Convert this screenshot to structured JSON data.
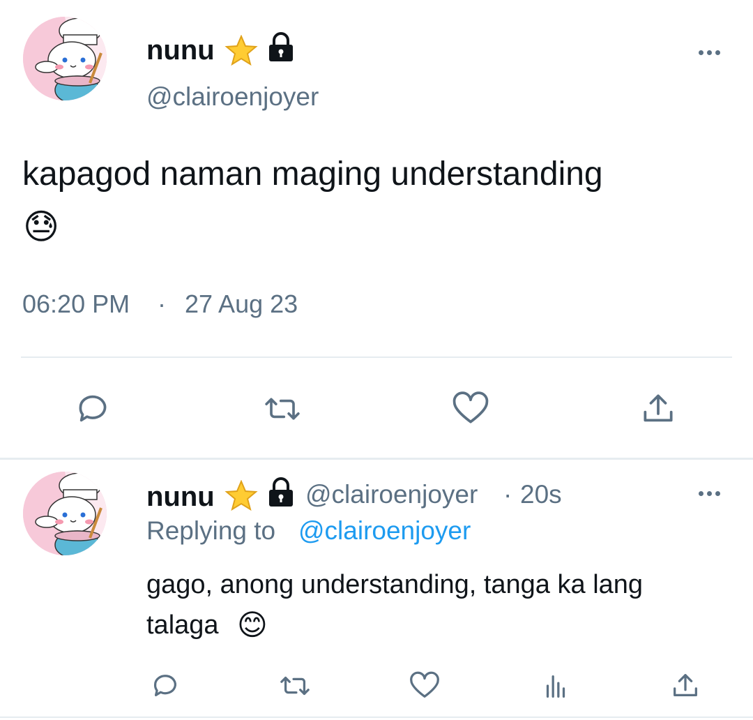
{
  "main_tweet": {
    "author_name": "nunu",
    "handle": "@clairoenjoyer",
    "text": "kapagod naman maging understanding",
    "emoji": "😓",
    "time": "06:20 PM",
    "separator": "·",
    "date": "27 Aug 23"
  },
  "reply": {
    "author_name": "nunu",
    "handle": "@clairoenjoyer",
    "dot": "·",
    "age": "20s",
    "replying_prefix": "Replying to",
    "replying_handle": "@clairoenjoyer",
    "text_line1": "gago, anong understanding, tanga ka lang",
    "text_line2": "talaga",
    "emoji": "😊"
  },
  "icons": {
    "verified_badge": "star-icon",
    "protected": "lock-icon",
    "more": "more-icon",
    "reply": "reply-icon",
    "retweet": "retweet-icon",
    "like": "heart-icon",
    "share": "share-icon",
    "analytics": "analytics-icon"
  },
  "colors": {
    "text": "#0f1419",
    "muted": "#5b7083",
    "link": "#1d9bf0",
    "divider": "#e6ecf0",
    "avatar_bg": "#f7c9d9"
  }
}
